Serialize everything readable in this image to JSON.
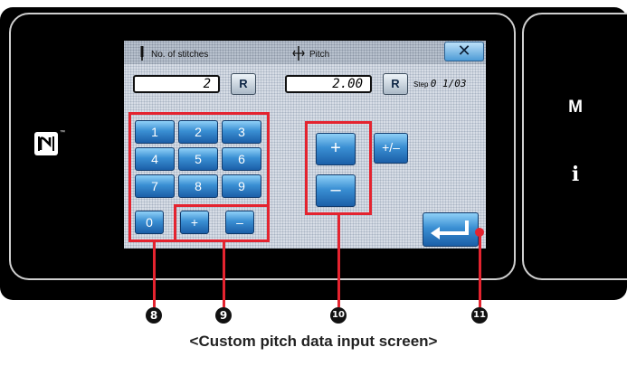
{
  "screen": {
    "stitches_label": "No. of stitches",
    "pitch_label": "Pitch",
    "close_label": "✕",
    "stitches_value": "2",
    "pitch_value": "2.00",
    "reset_label": "R",
    "step_label": "Step",
    "step_value": "0 1/03"
  },
  "numpad": {
    "keys": [
      "1",
      "2",
      "3",
      "4",
      "5",
      "6",
      "7",
      "8",
      "9",
      "0"
    ],
    "plus": "+",
    "minus": "–"
  },
  "pitch_pad": {
    "plus": "+",
    "minus": "–",
    "toggle": "+/–"
  },
  "side": {
    "m_label": "M",
    "i_label": "i",
    "nfc_tm": "™"
  },
  "callouts": [
    "8",
    "9",
    "10",
    "11"
  ],
  "caption": "<Custom pitch data input screen>",
  "colors": {
    "highlight": "#e4232f",
    "key_blue": "#2f7fc8"
  }
}
